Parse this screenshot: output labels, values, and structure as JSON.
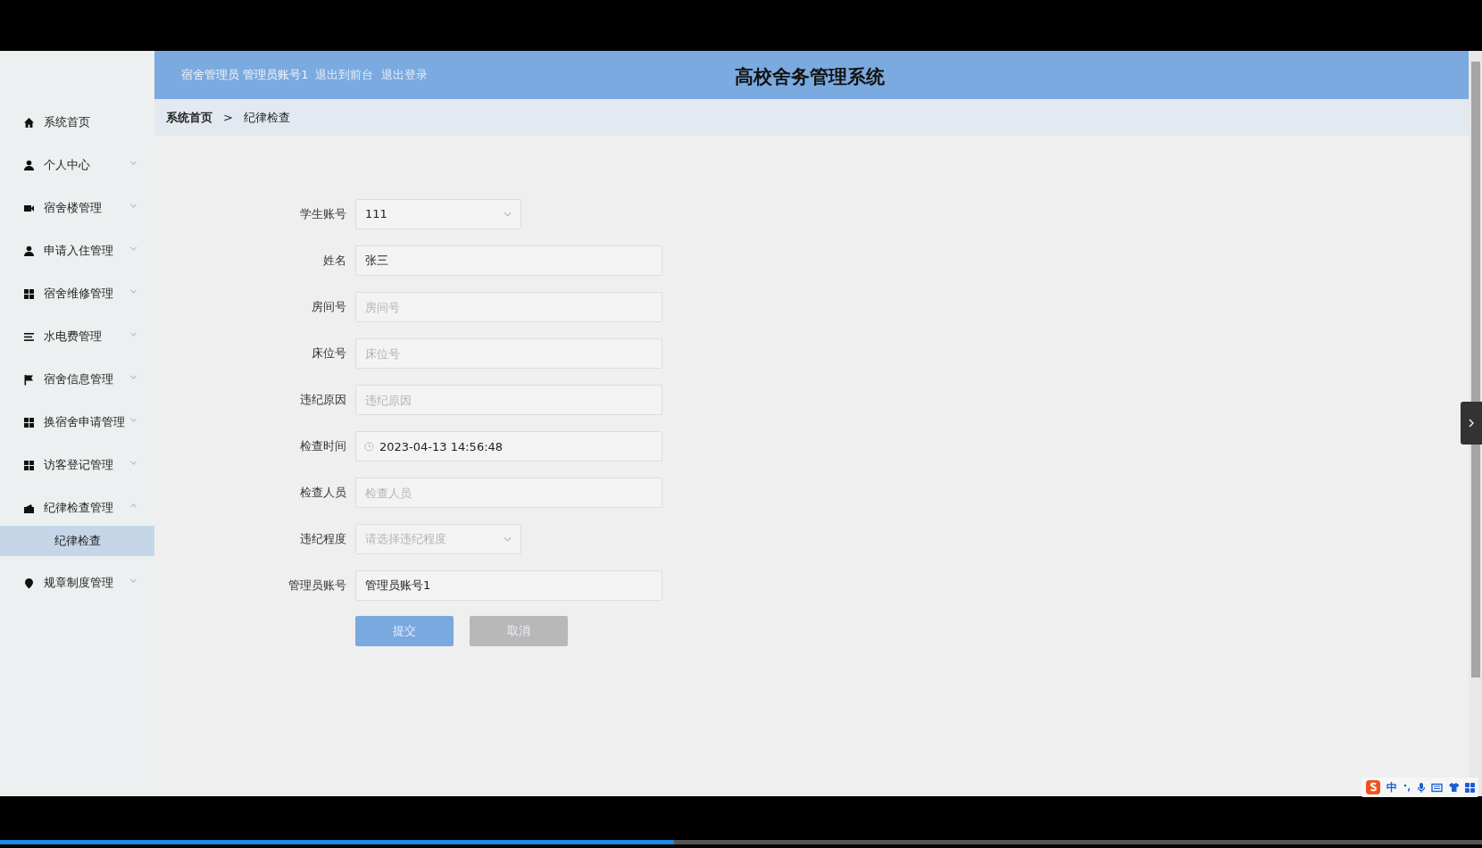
{
  "header": {
    "user_text": "宿舍管理员 管理员账号1",
    "links": [
      "退出到前台",
      "退出登录"
    ],
    "title": "高校舍务管理系统"
  },
  "breadcrumb": {
    "home": "系统首页",
    "separator": ">",
    "current": "纪律检查"
  },
  "sidebar": {
    "items": [
      {
        "label": "系统首页"
      },
      {
        "label": "个人中心",
        "expanded": false
      },
      {
        "label": "宿舍楼管理",
        "expanded": false
      },
      {
        "label": "申请入住管理",
        "expanded": false
      },
      {
        "label": "宿舍维修管理",
        "expanded": false
      },
      {
        "label": "水电费管理",
        "expanded": false
      },
      {
        "label": "宿舍信息管理",
        "expanded": false
      },
      {
        "label": "换宿舍申请管理",
        "expanded": false
      },
      {
        "label": "访客登记管理",
        "expanded": false
      },
      {
        "label": "纪律检查管理",
        "expanded": true,
        "children": [
          {
            "label": "纪律检查",
            "selected": true
          }
        ]
      },
      {
        "label": "规章制度管理",
        "expanded": false
      }
    ]
  },
  "form": {
    "fields": [
      {
        "label": "学生账号",
        "kind": "select",
        "value": "111"
      },
      {
        "label": "姓名",
        "kind": "input",
        "value": "张三"
      },
      {
        "label": "房间号",
        "kind": "input",
        "placeholder": "房间号"
      },
      {
        "label": "床位号",
        "kind": "input",
        "placeholder": "床位号"
      },
      {
        "label": "违纪原因",
        "kind": "input",
        "placeholder": "违纪原因"
      },
      {
        "label": "检查时间",
        "kind": "datetime",
        "value": "2023-04-13 14:56:48"
      },
      {
        "label": "检查人员",
        "kind": "input",
        "placeholder": "检查人员"
      },
      {
        "label": "违纪程度",
        "kind": "select",
        "placeholder": "请选择违纪程度"
      },
      {
        "label": "管理员账号",
        "kind": "input",
        "value": "管理员账号1"
      }
    ],
    "buttons": [
      {
        "label": "提交",
        "kind": "primary"
      },
      {
        "label": "取消",
        "kind": "secondary"
      }
    ]
  },
  "ime_toolbar": {
    "mode": "中"
  },
  "video_progress": {
    "level": 0.455
  }
}
